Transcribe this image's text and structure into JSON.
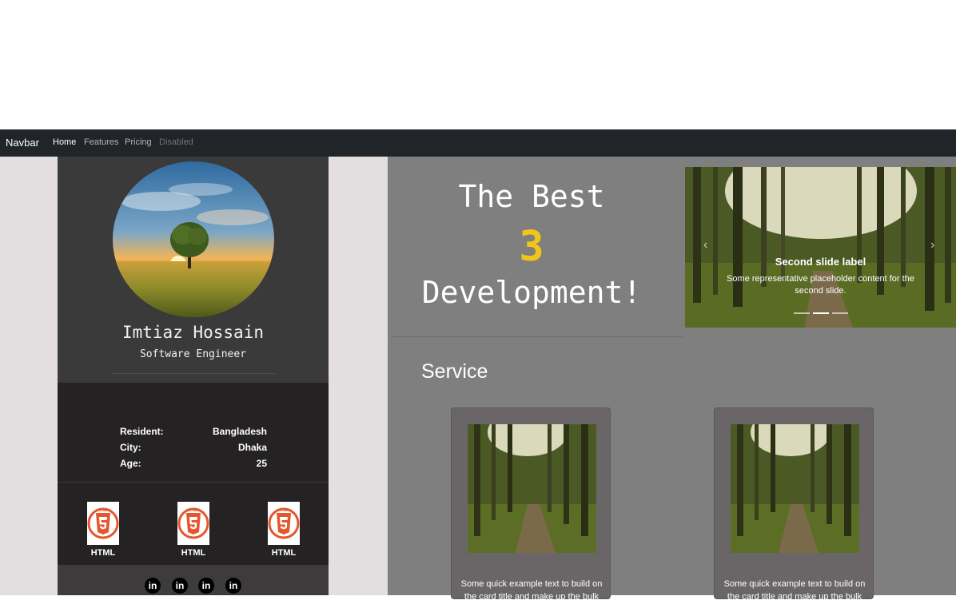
{
  "navbar": {
    "brand": "Navbar",
    "links": [
      {
        "label": "Home",
        "state": "active"
      },
      {
        "label": "Features",
        "state": "normal"
      },
      {
        "label": "Pricing",
        "state": "normal"
      },
      {
        "label": "Disabled",
        "state": "disabled"
      }
    ]
  },
  "profile": {
    "name": "Imtiaz Hossain",
    "title": "Software Engineer",
    "info": [
      {
        "key": "Resident:",
        "value": "Bangladesh"
      },
      {
        "key": "City:",
        "value": "Dhaka"
      },
      {
        "key": "Age:",
        "value": "25"
      }
    ],
    "skills": [
      {
        "label": "HTML",
        "icon": "html5-icon"
      },
      {
        "label": "HTML",
        "icon": "html5-icon"
      },
      {
        "label": "HTML",
        "icon": "html5-icon"
      }
    ],
    "social": [
      {
        "label": "in",
        "icon": "linkedin-icon"
      },
      {
        "label": "in",
        "icon": "linkedin-icon"
      },
      {
        "label": "in",
        "icon": "linkedin-icon"
      },
      {
        "label": "in",
        "icon": "linkedin-icon"
      }
    ]
  },
  "hero": {
    "line1": "The Best",
    "number": "3",
    "line3": "Development!"
  },
  "carousel": {
    "title": "Second slide label",
    "text": "Some representative placeholder content for the second slide.",
    "active_slide": 2,
    "slide_count": 3
  },
  "service": {
    "title": "Service",
    "cards": [
      {
        "text": "Some quick example text to build on the card title and make up the bulk of"
      },
      {
        "text": "Some quick example text to build on the card title and make up the bulk of"
      }
    ]
  },
  "colors": {
    "navbar_bg": "#212529",
    "accent_yellow": "#f2c618",
    "html5_orange": "#e4572e"
  }
}
